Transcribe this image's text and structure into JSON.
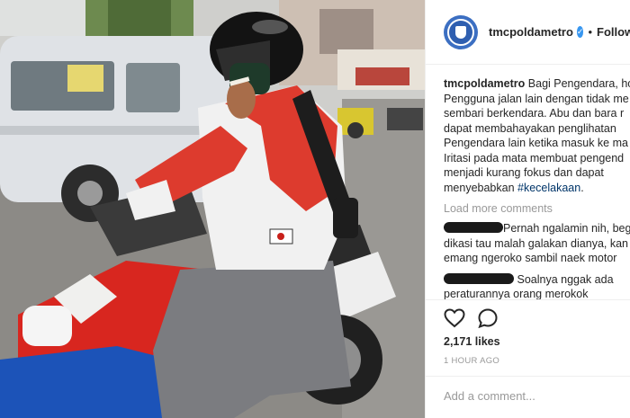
{
  "header": {
    "username": "tmcpoldametro",
    "verified_glyph": "✓",
    "separator": "•",
    "follow_label": "Follow"
  },
  "caption": {
    "username": "tmcpoldametro",
    "lines": [
      "Bagi Pengendara, ho",
      "Pengguna jalan lain dengan tidak me",
      "sembari berkendara. Abu dan bara r",
      "dapat membahayakan penglihatan",
      "Pengendara lain ketika masuk ke ma",
      "Iritasi pada mata membuat pengend",
      "menjadi kurang fokus dan dapat",
      "menyebabkan "
    ],
    "hashtag": "#kecelakaan",
    "end": "."
  },
  "load_more_label": "Load more comments",
  "comments": [
    {
      "lines": [
        "Pernah ngalamin nih, beg",
        "dikasi tau malah galakan dianya, kan",
        "emang ngeroko sambil naek motor"
      ]
    },
    {
      "lines": [
        "Soalnya nggak ada",
        "peraturannya orang merokok"
      ]
    }
  ],
  "icons": {
    "like": "heart-icon",
    "comment": "comment-icon",
    "avatar": "police-badge-icon"
  },
  "likes_label": "2,171 likes",
  "time_label": "1 HOUR AGO",
  "add_comment_placeholder": "Add a comment...",
  "colors": {
    "link": "#003569",
    "verified": "#3897f0",
    "muted": "#999999",
    "avatar": "#3c6fc2"
  }
}
